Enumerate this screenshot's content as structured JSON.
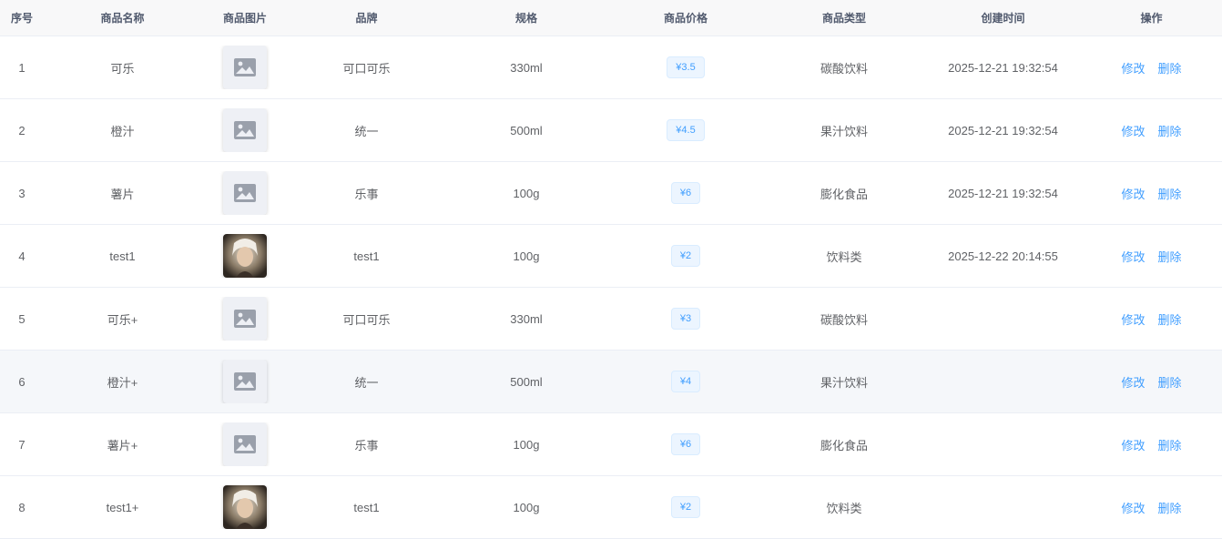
{
  "columns": [
    "序号",
    "商品名称",
    "商品图片",
    "品牌",
    "规格",
    "商品价格",
    "商品类型",
    "创建时间",
    "操作"
  ],
  "actions": {
    "edit_label": "修改",
    "delete_label": "删除"
  },
  "colors": {
    "accent": "#409eff",
    "tag_bg": "#ecf5ff",
    "header_bg": "#f8f8f9",
    "hover_row_bg": "#f5f7fa"
  },
  "rows": [
    {
      "index": "1",
      "name": "可乐",
      "image": "placeholder-image-icon",
      "brand": "可口可乐",
      "spec": "330ml",
      "price": "¥3.5",
      "type": "碳酸饮料",
      "created": "2025-12-21 19:32:54"
    },
    {
      "index": "2",
      "name": "橙汁",
      "image": "placeholder-image-icon",
      "brand": "统一",
      "spec": "500ml",
      "price": "¥4.5",
      "type": "果汁饮料",
      "created": "2025-12-21 19:32:54"
    },
    {
      "index": "3",
      "name": "薯片",
      "image": "placeholder-image-icon",
      "brand": "乐事",
      "spec": "100g",
      "price": "¥6",
      "type": "膨化食品",
      "created": "2025-12-21 19:32:54"
    },
    {
      "index": "4",
      "name": "test1",
      "image": "product-photo",
      "brand": "test1",
      "spec": "100g",
      "price": "¥2",
      "type": "饮料类",
      "created": "2025-12-22 20:14:55"
    },
    {
      "index": "5",
      "name": "可乐+",
      "image": "placeholder-image-icon",
      "brand": "可口可乐",
      "spec": "330ml",
      "price": "¥3",
      "type": "碳酸饮料",
      "created": ""
    },
    {
      "index": "6",
      "name": "橙汁+",
      "image": "placeholder-image-icon",
      "brand": "统一",
      "spec": "500ml",
      "price": "¥4",
      "type": "果汁饮料",
      "created": ""
    },
    {
      "index": "7",
      "name": "薯片+",
      "image": "placeholder-image-icon",
      "brand": "乐事",
      "spec": "100g",
      "price": "¥6",
      "type": "膨化食品",
      "created": ""
    },
    {
      "index": "8",
      "name": "test1+",
      "image": "product-photo",
      "brand": "test1",
      "spec": "100g",
      "price": "¥2",
      "type": "饮料类",
      "created": ""
    }
  ]
}
